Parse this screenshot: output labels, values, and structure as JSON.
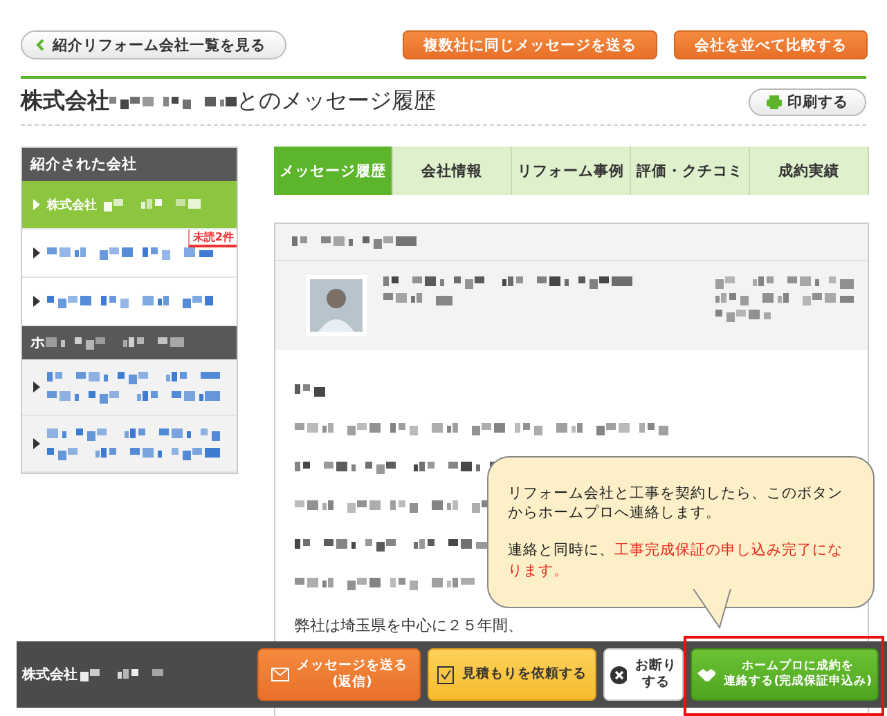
{
  "back_button": "紹介リフォーム会社一覧を見る",
  "action_buttons": [
    "複数社に同じメッセージを送る",
    "会社を並べて比較する"
  ],
  "heading": {
    "prefix": "株式会社",
    "suffix": "とのメッセージ履歴"
  },
  "print_button": "印刷する",
  "sidebar": {
    "sections": [
      {
        "title": "紹介された会社",
        "items": [
          {
            "label": "株式会社",
            "selected": true
          },
          {
            "selected": false,
            "badge": "未読2件"
          },
          {
            "selected": false
          }
        ]
      },
      {
        "title": "ホ",
        "items": [
          {
            "selected": false
          },
          {
            "selected": false
          }
        ]
      }
    ]
  },
  "tabs": [
    {
      "label": "メッセージ履歴",
      "selected": true
    },
    {
      "label": "会社情報",
      "selected": false
    },
    {
      "label": "リフォーム事例",
      "selected": false
    },
    {
      "label": "評価・クチコミ",
      "selected": false
    },
    {
      "label": "成約実績",
      "selected": false
    }
  ],
  "message": {
    "visible_line": "弊社は埼玉県を中心に２５年間、"
  },
  "bottom_bar": {
    "company": "株式会社",
    "buttons": [
      {
        "kind": "message",
        "lines": [
          "メッセージを送る",
          "(返信)"
        ]
      },
      {
        "kind": "estimate",
        "lines": [
          "見積もりを依頼する"
        ]
      },
      {
        "kind": "decline",
        "lines": [
          "お断り",
          "する"
        ]
      },
      {
        "kind": "contract",
        "lines": [
          "ホームプロに成約を",
          "連絡する(完成保証申込み)"
        ]
      }
    ]
  },
  "tooltip": {
    "text": "リフォーム会社と工事を契約したら、このボタンからホームプロへ連絡します。",
    "lead": "連絡と同時に、",
    "highlight": "工事完成保証の申し込み完了になります。"
  }
}
